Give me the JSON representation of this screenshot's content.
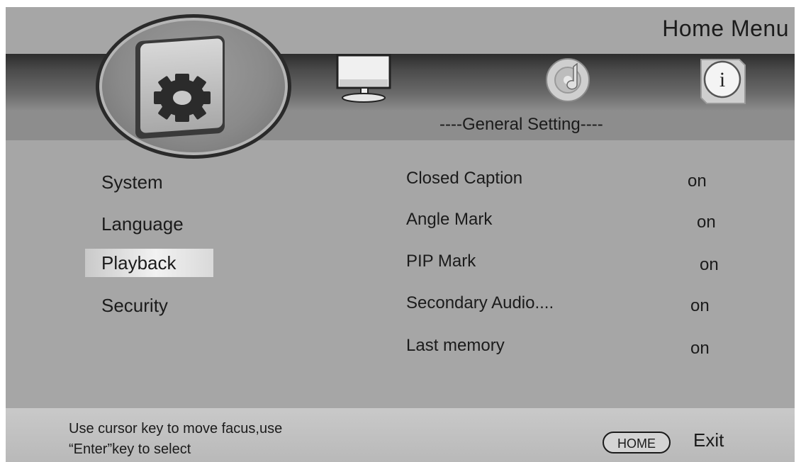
{
  "header": {
    "title": "Home  Menu",
    "subtitle": "----General Setting----"
  },
  "icons": {
    "active": "settings-gear-icon",
    "tabs": [
      "monitor-icon",
      "disc-music-icon",
      "info-icon"
    ]
  },
  "sidebar": {
    "items": [
      {
        "label": "System",
        "selected": false
      },
      {
        "label": "Language",
        "selected": false
      },
      {
        "label": "Playback",
        "selected": true
      },
      {
        "label": "Security",
        "selected": false
      }
    ]
  },
  "settings": [
    {
      "label": "Closed Caption",
      "value": "on"
    },
    {
      "label": "Angle Mark",
      "value": "on"
    },
    {
      "label": "PIP  Mark",
      "value": "on"
    },
    {
      "label": "Secondary Audio....",
      "value": "on"
    },
    {
      "label": "Last memory",
      "value": "on"
    }
  ],
  "footer": {
    "hint_line1": "Use cursor key to move facus,use",
    "hint_line2": "“Enter”key to select",
    "home_key": "HOME",
    "exit_label": "Exit"
  },
  "colors": {
    "background": "#a6a6a6",
    "band_dark": "#2c2c2c",
    "selection": "#f2f2f2",
    "text": "#1b1b1b"
  }
}
